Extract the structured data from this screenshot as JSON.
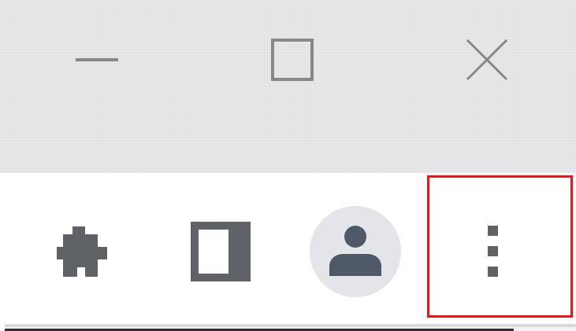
{
  "window_controls": {
    "minimize": {
      "icon": "minimize-icon"
    },
    "maximize": {
      "icon": "maximize-icon"
    },
    "close": {
      "icon": "close-icon"
    }
  },
  "toolbar": {
    "extensions": {
      "icon": "puzzle-icon"
    },
    "side_panel": {
      "icon": "side-panel-icon"
    },
    "profile": {
      "icon": "person-icon"
    },
    "menu": {
      "icon": "more-vertical-icon"
    }
  },
  "colors": {
    "titlebar_bg": "#e6e7e9",
    "toolbar_bg": "#ffffff",
    "icon_gray": "#5f6368",
    "window_control_gray": "#888888",
    "avatar_bg": "#e3e5e8",
    "avatar_fg": "#4f5866",
    "highlight": "#e8151b"
  }
}
